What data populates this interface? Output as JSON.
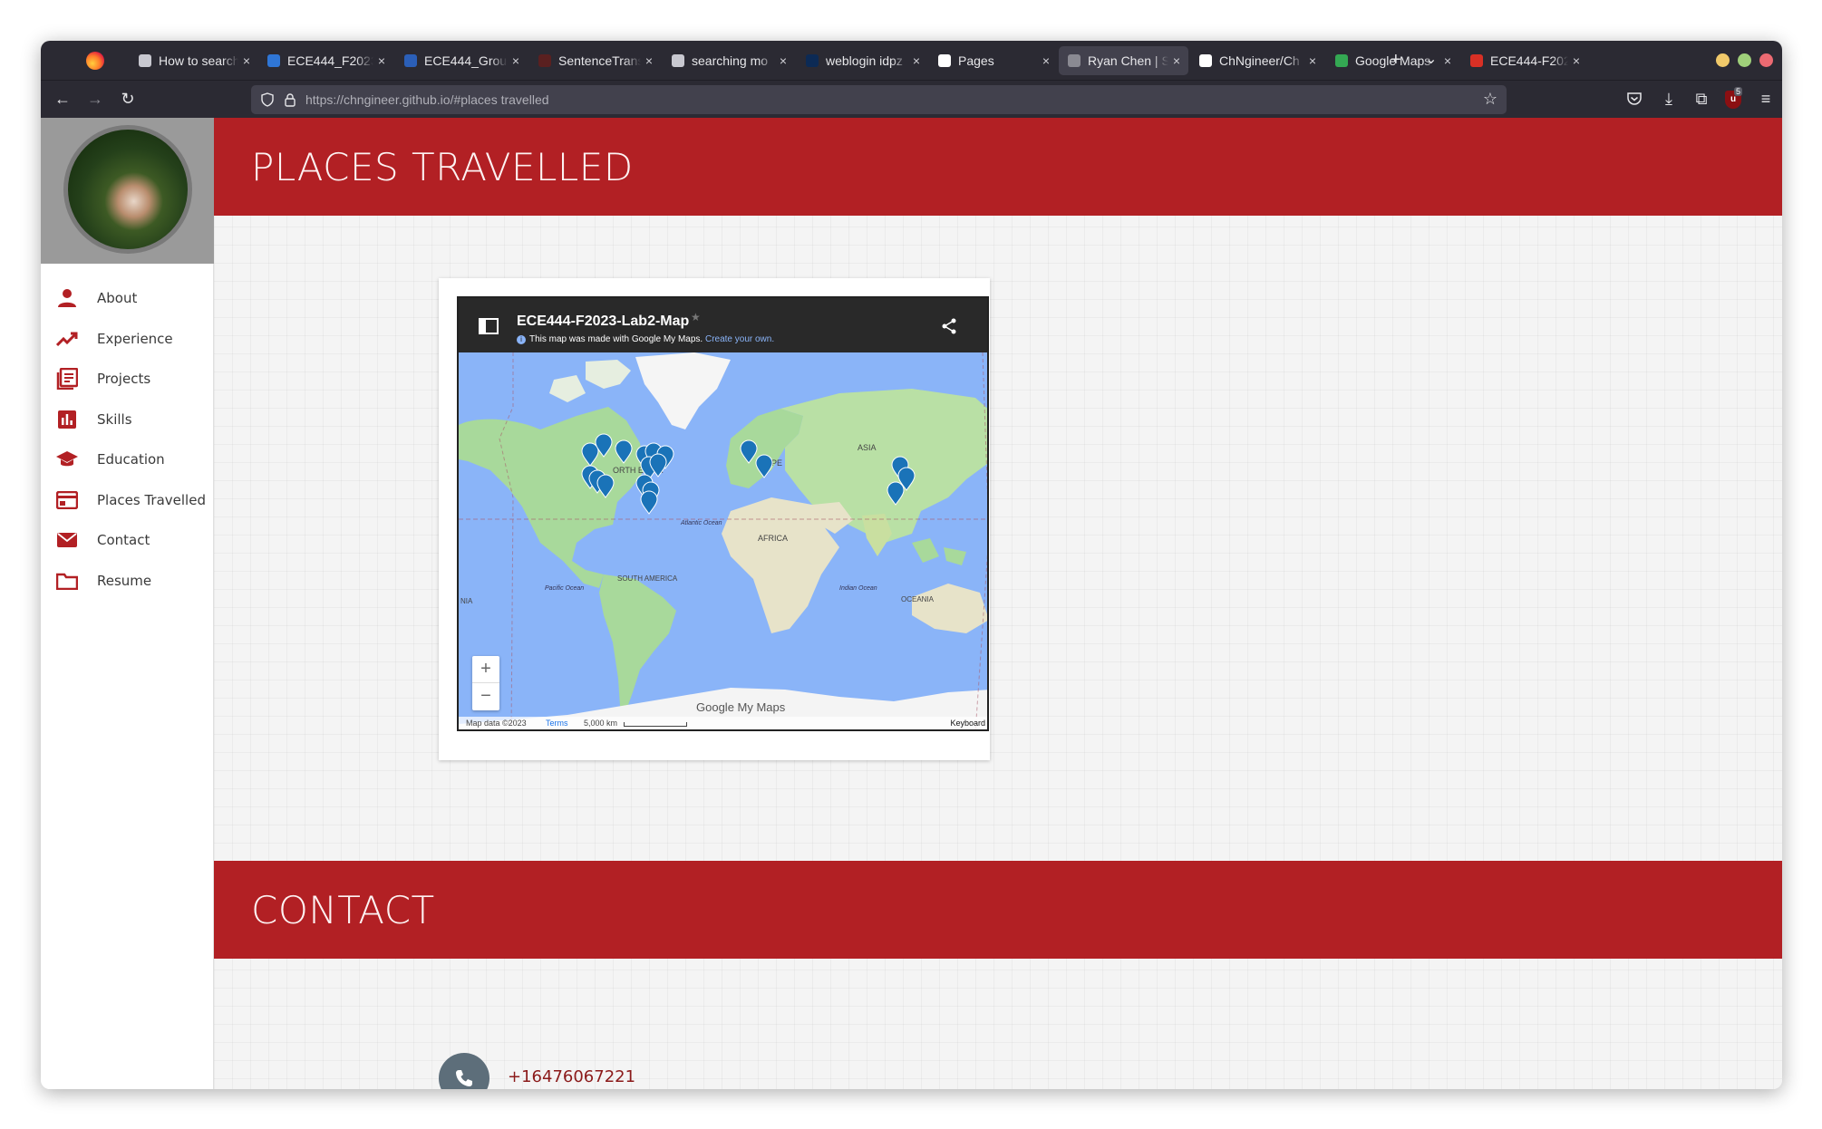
{
  "browser": {
    "tabs": [
      {
        "label": "How to search",
        "favicon_color": "#c8c8d0",
        "active": false
      },
      {
        "label": "ECE444_F2023",
        "favicon_color": "#2f76d6",
        "active": false
      },
      {
        "label": "ECE444_Group",
        "favicon_color": "#2b5fb8",
        "active": false
      },
      {
        "label": "SentenceTrans",
        "favicon_color": "#5a2020",
        "active": false
      },
      {
        "label": "searching mo",
        "favicon_color": "#c8c8d0",
        "active": false
      },
      {
        "label": "weblogin idpz",
        "favicon_color": "#0c2a55",
        "active": false
      },
      {
        "label": "Pages",
        "favicon_color": "#ffffff",
        "active": false
      },
      {
        "label": "Ryan Chen | S",
        "favicon_color": "#8a8a92",
        "active": true
      },
      {
        "label": "ChNgineer/Ch",
        "favicon_color": "#ffffff",
        "active": false
      },
      {
        "label": "Google Maps",
        "favicon_color": "#34a853",
        "active": false
      },
      {
        "label": "ECE444-F2023",
        "favicon_color": "#d93025",
        "active": false
      }
    ],
    "url_host": "https://chngineer.github.io",
    "url_path": "/#places travelled",
    "badge_count": "5"
  },
  "sidebar": {
    "items": [
      {
        "label": "About",
        "icon": "person-icon"
      },
      {
        "label": "Experience",
        "icon": "trending-up-icon"
      },
      {
        "label": "Projects",
        "icon": "articles-icon"
      },
      {
        "label": "Skills",
        "icon": "bar-chart-icon"
      },
      {
        "label": "Education",
        "icon": "graduation-cap-icon"
      },
      {
        "label": "Places Travelled",
        "icon": "card-icon"
      },
      {
        "label": "Contact",
        "icon": "envelope-icon"
      },
      {
        "label": "Resume",
        "icon": "folder-icon"
      }
    ],
    "accent_color": "#b22024"
  },
  "sections": {
    "places_title": "PLACES TRAVELLED",
    "contact_title": "CONTACT"
  },
  "map": {
    "title": "ECE444-F2023-Lab2-Map",
    "note_prefix": "This map was made with Google My Maps.",
    "note_link": "Create your own.",
    "labels": {
      "asia": "ASIA",
      "europe": "OPE",
      "north_america": "ORTH ERICA",
      "africa": "AFRICA",
      "atlantic": "Atlantic Ocean",
      "pacific": "Pacific Ocean",
      "indian": "Indian Ocean",
      "south_america": "SOUTH AMERICA",
      "oceania": "OCEANIA",
      "edge": "NIA"
    },
    "brand": "Google My Maps",
    "attribution": "Map data ©2023",
    "terms": "Terms",
    "scale": "5,000 km",
    "keyboard": "Keyboard",
    "zoom_in": "+",
    "zoom_out": "−"
  },
  "contact": {
    "phone": "+16476067221"
  }
}
